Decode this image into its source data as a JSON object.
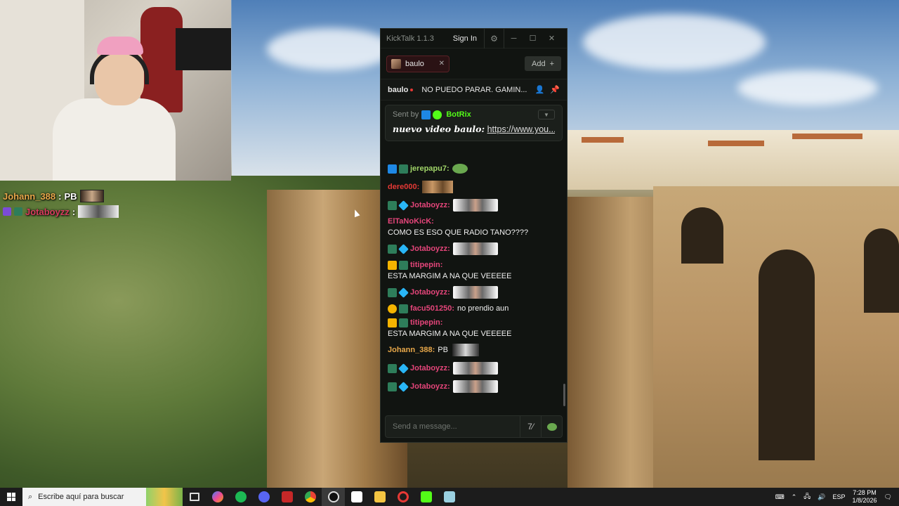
{
  "overlay": {
    "lines": [
      {
        "user": "Johann_388",
        "sep": ":",
        "text": "PB"
      },
      {
        "user": "Jotaboyzz",
        "sep": ":",
        "text": ""
      }
    ]
  },
  "app": {
    "title": "KickTalk 1.1.3",
    "sign_in": "Sign In",
    "tab_label": "baulo",
    "add_label": "Add",
    "streamer": "baulo",
    "stream_title": "NO PUEDO PARAR. GAMIN...",
    "pinned": {
      "sent_by": "Sent by",
      "bot_name": "BotRix",
      "message": "nuevo video baulo:",
      "link": "https://www.you..."
    },
    "messages": [
      {
        "user": "jerepapu7:",
        "text": "",
        "color": "#a0d468"
      },
      {
        "user": "dere000:",
        "text": "",
        "color": "#e53935"
      },
      {
        "user": "Jotaboyzz:",
        "text": "",
        "color": "#e5457a"
      },
      {
        "user": "ElTaNoKicK:",
        "text": "COMO ES ESO QUE RADIO TANO????",
        "color": "#e5457a"
      },
      {
        "user": "Jotaboyzz:",
        "text": "",
        "color": "#e5457a"
      },
      {
        "user": "titipepin:",
        "text": "ESTA MARGIM A NA QUE VEEEEE",
        "color": "#e5457a"
      },
      {
        "user": "Jotaboyzz:",
        "text": "",
        "color": "#e5457a"
      },
      {
        "user": "facu501250:",
        "text": "no prendio aun",
        "color": "#e5457a"
      },
      {
        "user": "titipepin:",
        "text": "ESTA MARGIM A NA QUE VEEEEE",
        "color": "#e5457a"
      },
      {
        "user": "Johann_388:",
        "text": "PB",
        "color": "#e8a84a"
      },
      {
        "user": "Jotaboyzz:",
        "text": "",
        "color": "#e5457a"
      },
      {
        "user": "Jotaboyzz:",
        "text": "",
        "color": "#e5457a"
      }
    ],
    "input_placeholder": "Send a message..."
  },
  "taskbar": {
    "search_placeholder": "Escribe aquí para buscar",
    "language": "ESP",
    "time": "7:28 PM",
    "date": "1/8/2026"
  },
  "colors": {
    "kick_green": "#53fc18",
    "app_bg": "#111411",
    "tab_bg": "#2a1214"
  }
}
